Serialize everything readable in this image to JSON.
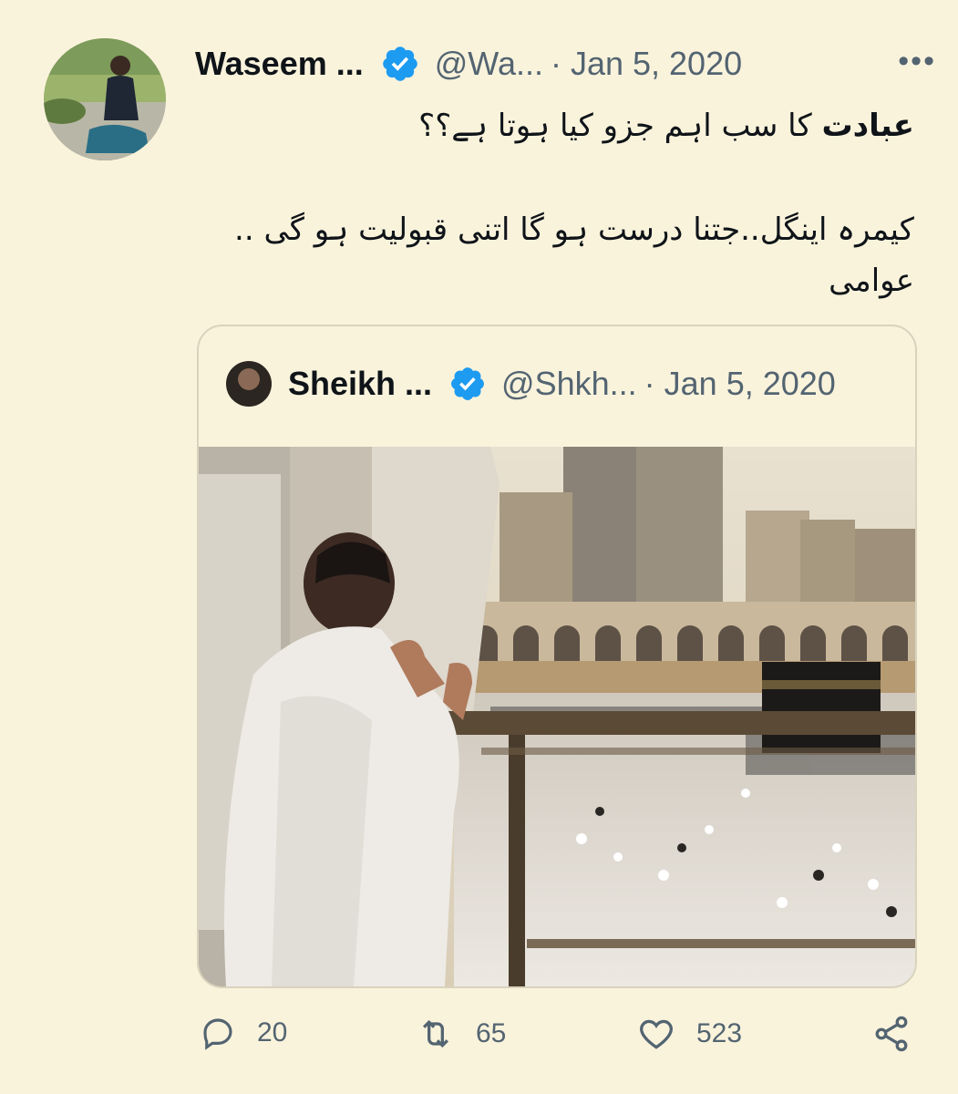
{
  "tweet": {
    "author_name": "Waseem ...",
    "handle": "@Wa...",
    "date": "· Jan 5, 2020",
    "more_icon": "more-icon",
    "text_bold": "عبادت",
    "text_line1": " کا سب اہم جزو کیا ہوتا ہے؟؟",
    "text_line2": "کیمرہ اینگل..جتنا درست ہو گا اتنی قبولیت ہو گی ..",
    "text_line3": "عوامی"
  },
  "quoted": {
    "author_name": "Sheikh ...",
    "handle": "@Shkh...",
    "date": "· Jan 5, 2020"
  },
  "actions": {
    "replies": "20",
    "retweets": "65",
    "likes": "523"
  },
  "colors": {
    "background": "#faf3dc",
    "verified_blue": "#1d9bf0",
    "muted_text": "#536471"
  }
}
